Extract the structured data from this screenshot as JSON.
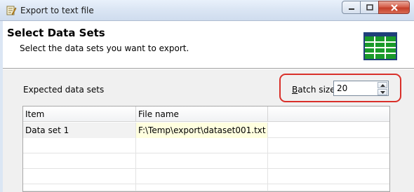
{
  "window": {
    "title": "Export to text file",
    "icon": "notepad-pencil-icon"
  },
  "header": {
    "title": "Select Data Sets",
    "subtitle": "Select the data sets you want to export.",
    "icon": "green-grid-table-icon"
  },
  "batch": {
    "label_accel": "B",
    "label_rest": "atch size",
    "value": "20"
  },
  "expected_label": "Expected data sets",
  "table": {
    "columns": [
      "Item",
      "File name",
      ""
    ],
    "rows": [
      {
        "item": "Data set 1",
        "file": "F:\\Temp\\export\\dataset001.txt"
      },
      {
        "item": "",
        "file": ""
      },
      {
        "item": "",
        "file": ""
      },
      {
        "item": "",
        "file": ""
      },
      {
        "item": "",
        "file": ""
      }
    ]
  },
  "colors": {
    "highlight": "#d9302a",
    "file_cell_bg": "#ffffdf",
    "grid_icon": "#1a9b2a"
  }
}
